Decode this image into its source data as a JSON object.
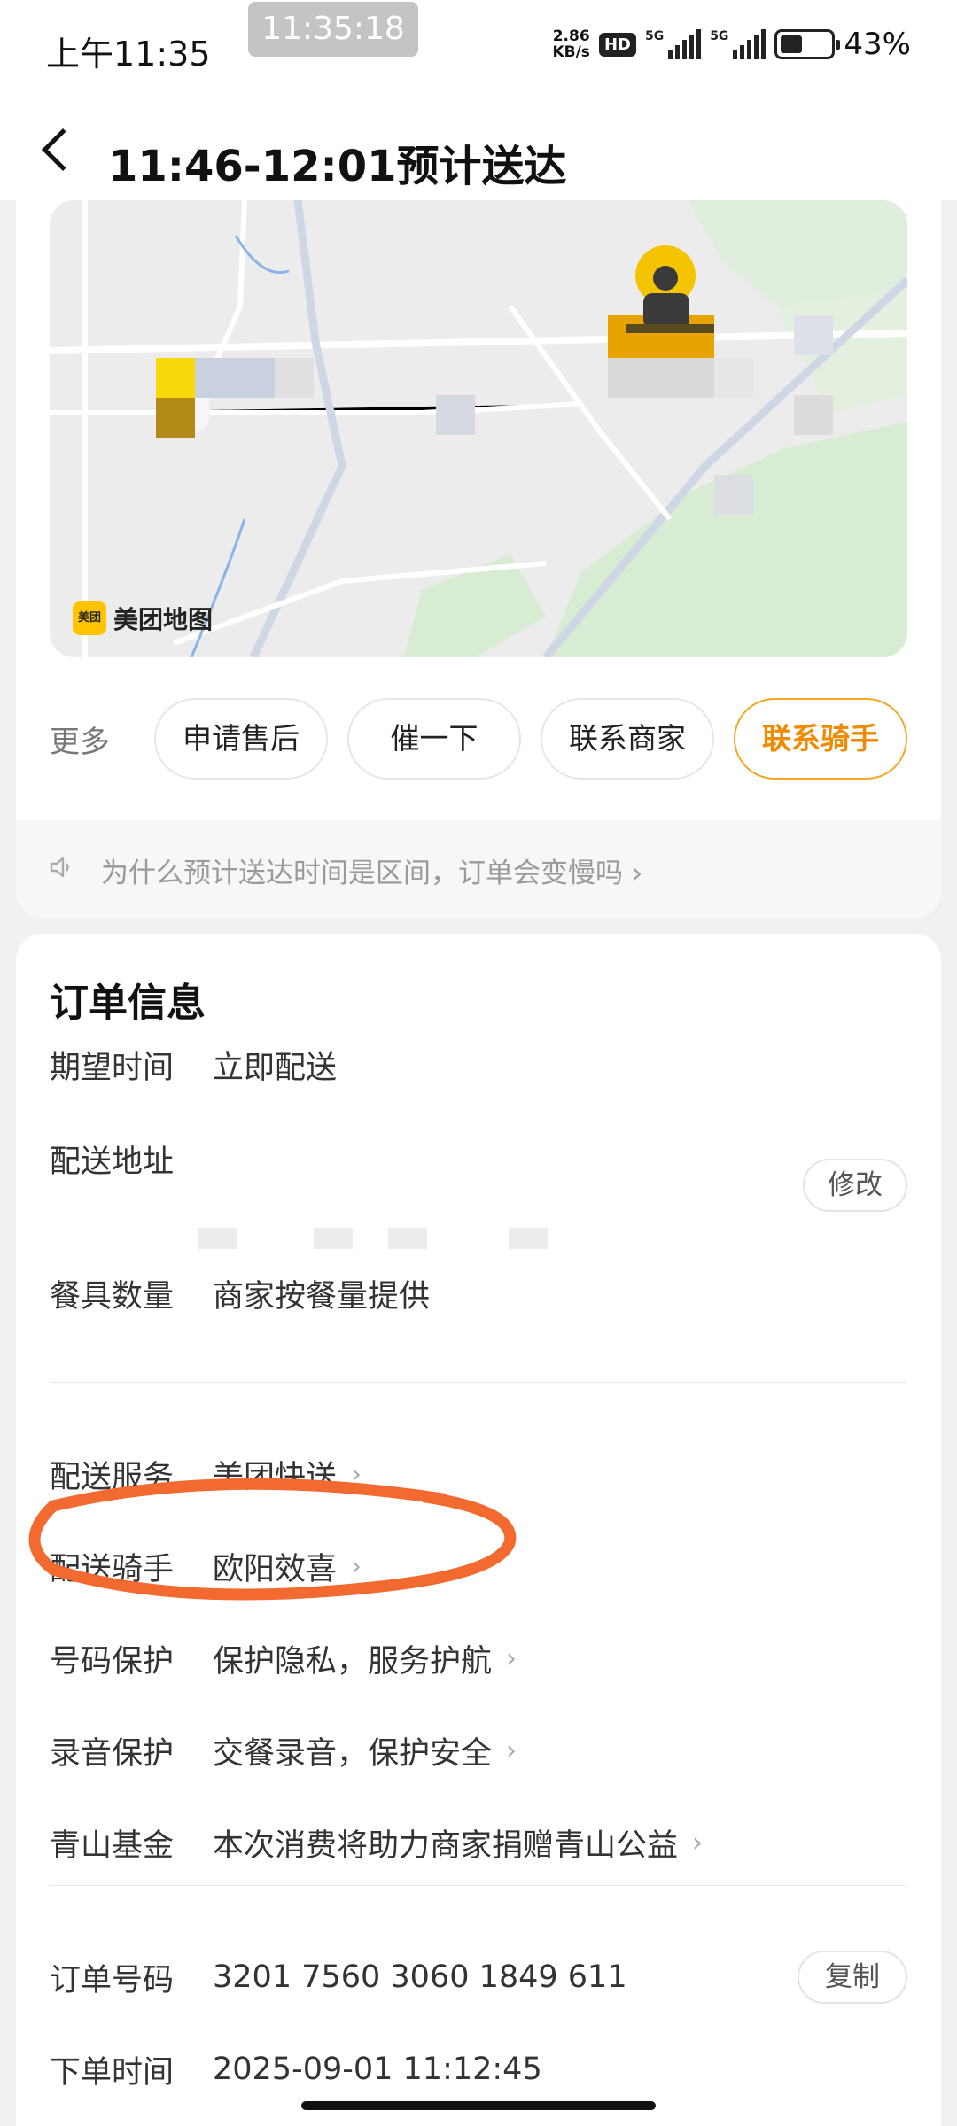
{
  "status_bar": {
    "time": "上午11:35",
    "overlay_time": "11:35:18",
    "net_speed_value": "2.86",
    "net_speed_unit": "KB/s",
    "hd_label": "HD",
    "signal_label_1": "5G",
    "signal_label_2": "5G",
    "battery_level": 0.43,
    "battery_text": "43%"
  },
  "header": {
    "title": "11:46-12:01预计送达",
    "back_icon": "back-arrow-icon"
  },
  "map": {
    "logo_mark": "美团",
    "logo_text": "美团地图",
    "courier_icon": "rider-icon",
    "colors": {
      "rider": "#f5b800",
      "marker": "#f5d90a"
    }
  },
  "actions": {
    "more_label": "更多",
    "buttons": [
      "申请售后",
      "催一下",
      "联系商家",
      "联系骑手"
    ],
    "primary_color": "#f08a00"
  },
  "notice": {
    "icon": "speaker-icon",
    "text": "为什么预计送达时间是区间，订单会变慢吗",
    "chevron": "›"
  },
  "order_info": {
    "title": "订单信息",
    "expected_time": {
      "label": "期望时间",
      "value": "立即配送"
    },
    "address": {
      "label": "配送地址",
      "edit_label": "修改"
    },
    "tableware": {
      "label": "餐具数量",
      "value": "商家按餐量提供"
    },
    "service": {
      "label": "配送服务",
      "value": "美团快送"
    },
    "rider": {
      "label": "配送骑手",
      "value": "欧阳效喜"
    },
    "number_protect": {
      "label": "号码保护",
      "value": "保护隐私，服务护航"
    },
    "audio_protect": {
      "label": "录音保护",
      "value": "交餐录音，保护安全"
    },
    "fund": {
      "label": "青山基金",
      "value": "本次消费将助力商家捐赠青山公益"
    },
    "order_number": {
      "label": "订单号码",
      "value": "3201 7560 3060 1849 611",
      "copy_label": "复制"
    },
    "order_time": {
      "label": "下单时间",
      "value": "2025-09-01 11:12:45"
    },
    "chevron": "›"
  },
  "annotation": {
    "color": "#f26a30"
  }
}
